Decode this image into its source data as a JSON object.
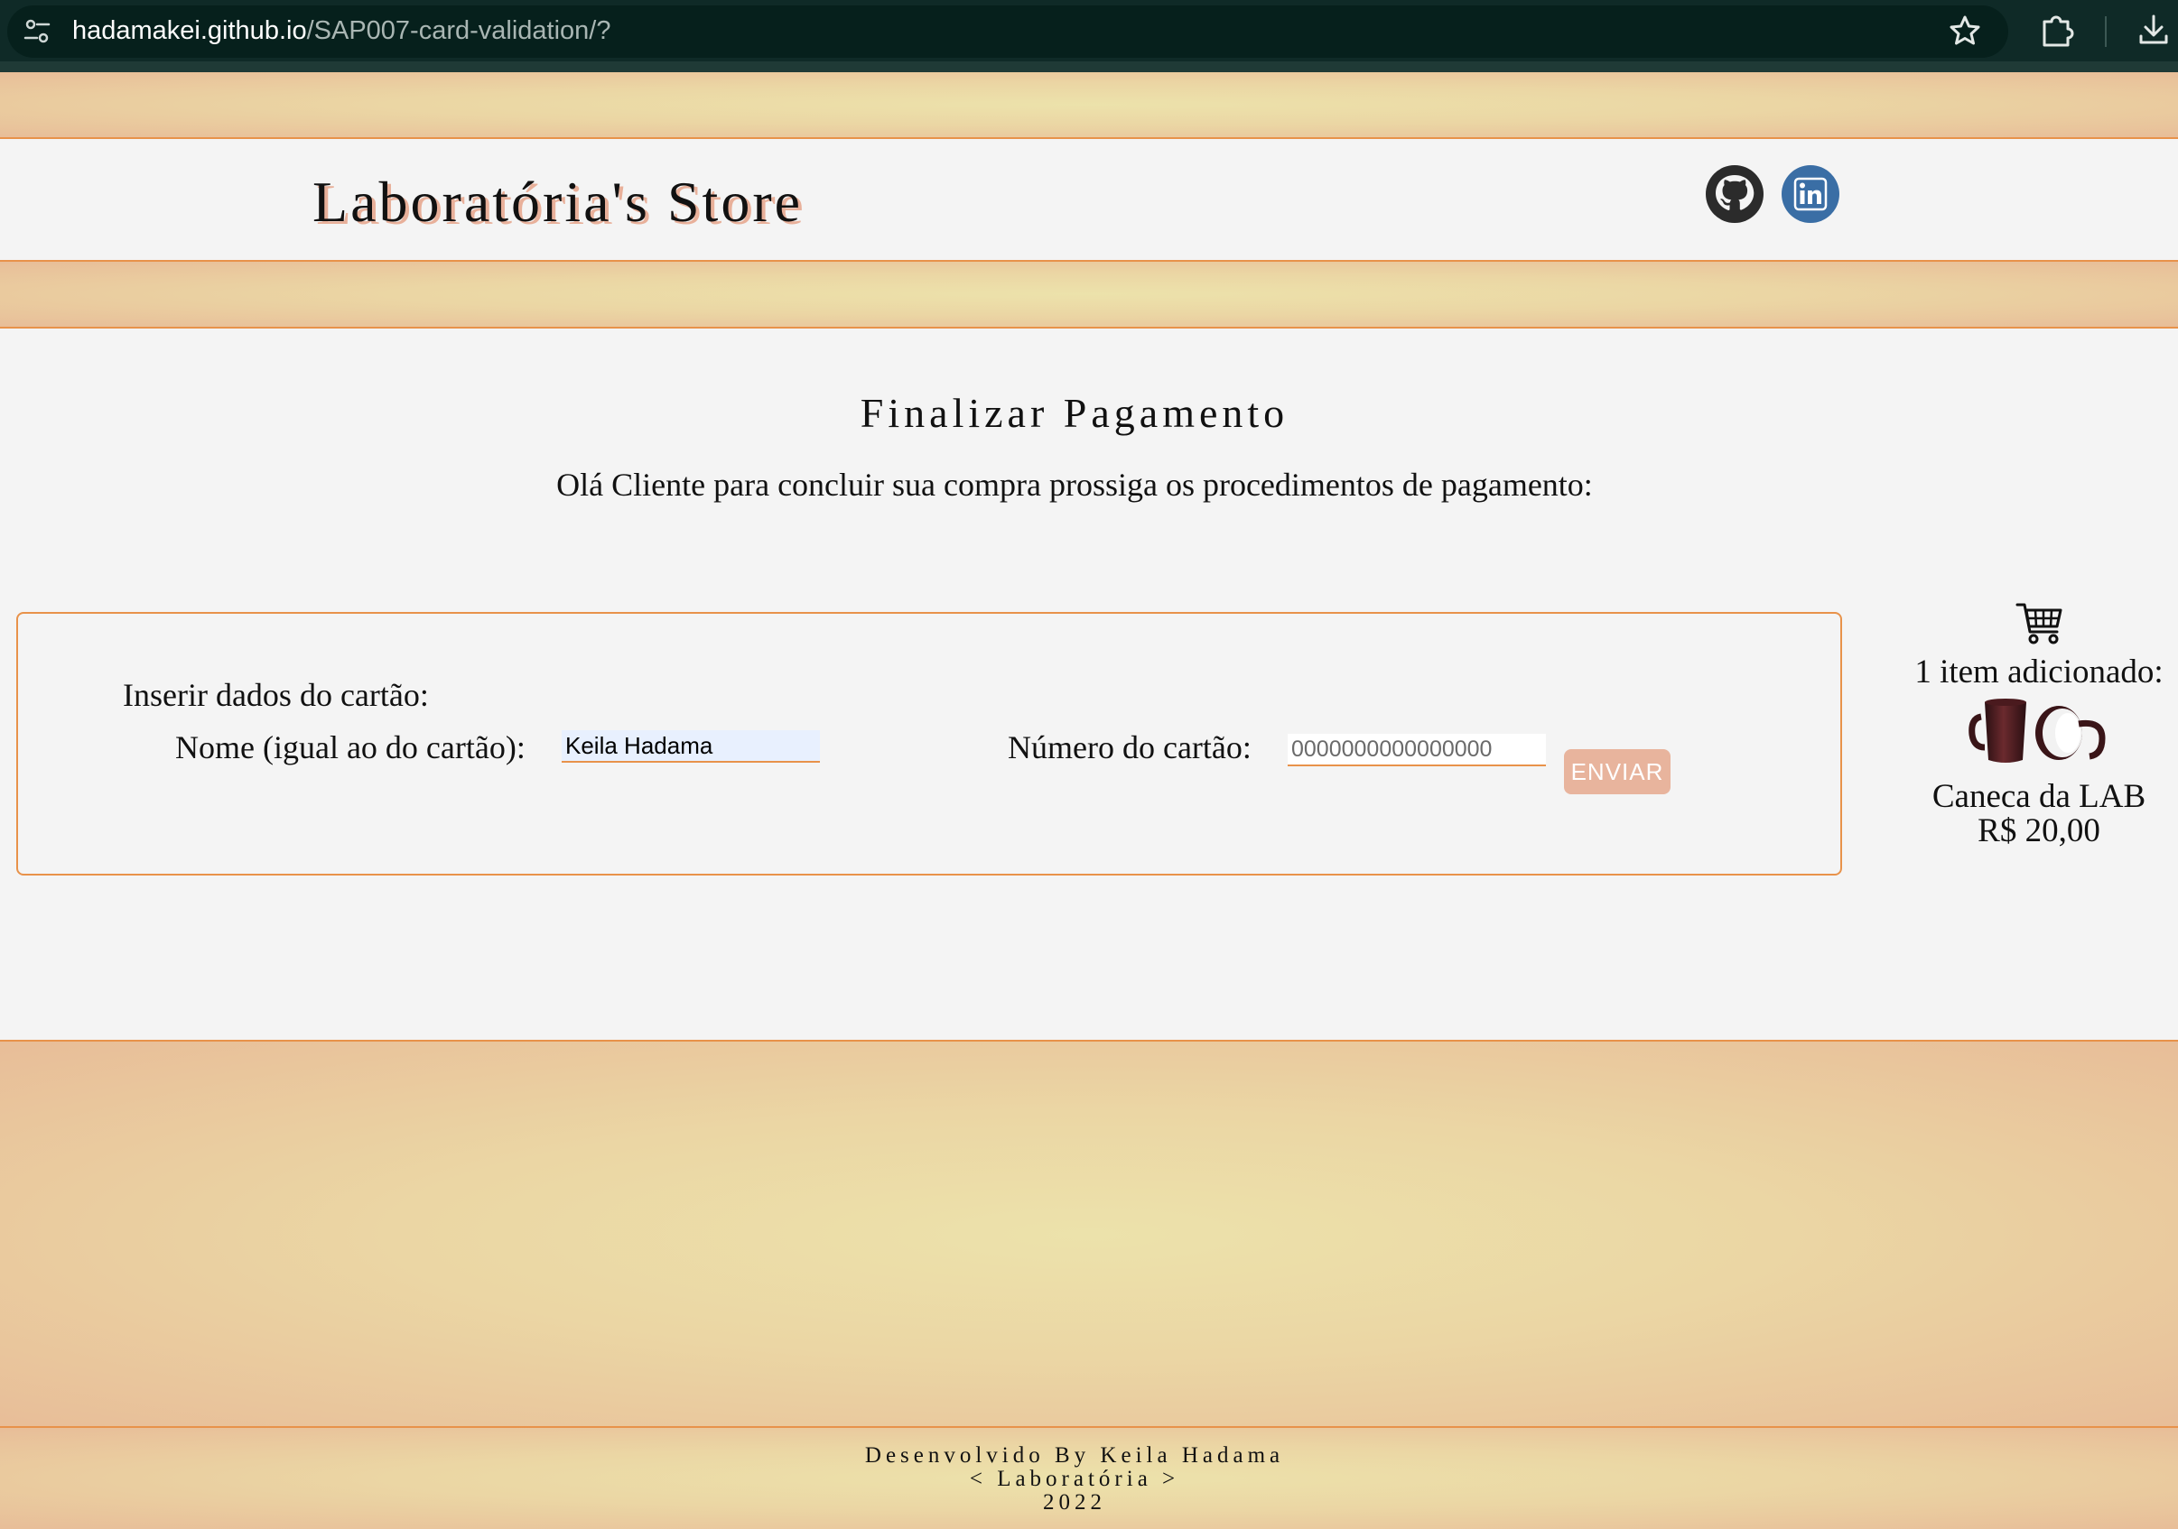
{
  "browser": {
    "url_host": "hadamakei.github.io",
    "url_path": "/SAP007-card-validation/?",
    "icons": [
      "site-info-icon",
      "star-icon",
      "extension-icon",
      "download-icon"
    ]
  },
  "header": {
    "title": "Laboratória's Store",
    "social_icons": [
      "github-icon",
      "linkedin-icon"
    ]
  },
  "main": {
    "page_title": "Finalizar Pagamento",
    "greeting": "Olá Cliente para concluir sua compra prossiga os procedimentos de pagamento:",
    "form": {
      "heading": "Inserir dados do cartão:",
      "name_label": "Nome (igual ao do cartão):",
      "name_value": "Keila Hadama",
      "card_number_label": "Número do cartão:",
      "card_number_placeholder": "0000000000000000",
      "submit_label": "ENVIAR"
    }
  },
  "cart": {
    "icon": "cart-icon",
    "count_text": "1 item adicionado:",
    "product_name": "Caneca da LAB",
    "product_price": "R$ 20,00"
  },
  "footer": {
    "line1": "Desenvolvido By Keila Hadama",
    "line2": "< Laboratória >",
    "line3": "2022"
  },
  "colors": {
    "accent_line": "#e8924a",
    "band_center": "#ece2ab",
    "band_edge": "#e8bd98",
    "button_bg": "#e8b49d",
    "browser_bar": "#0f2a27"
  }
}
